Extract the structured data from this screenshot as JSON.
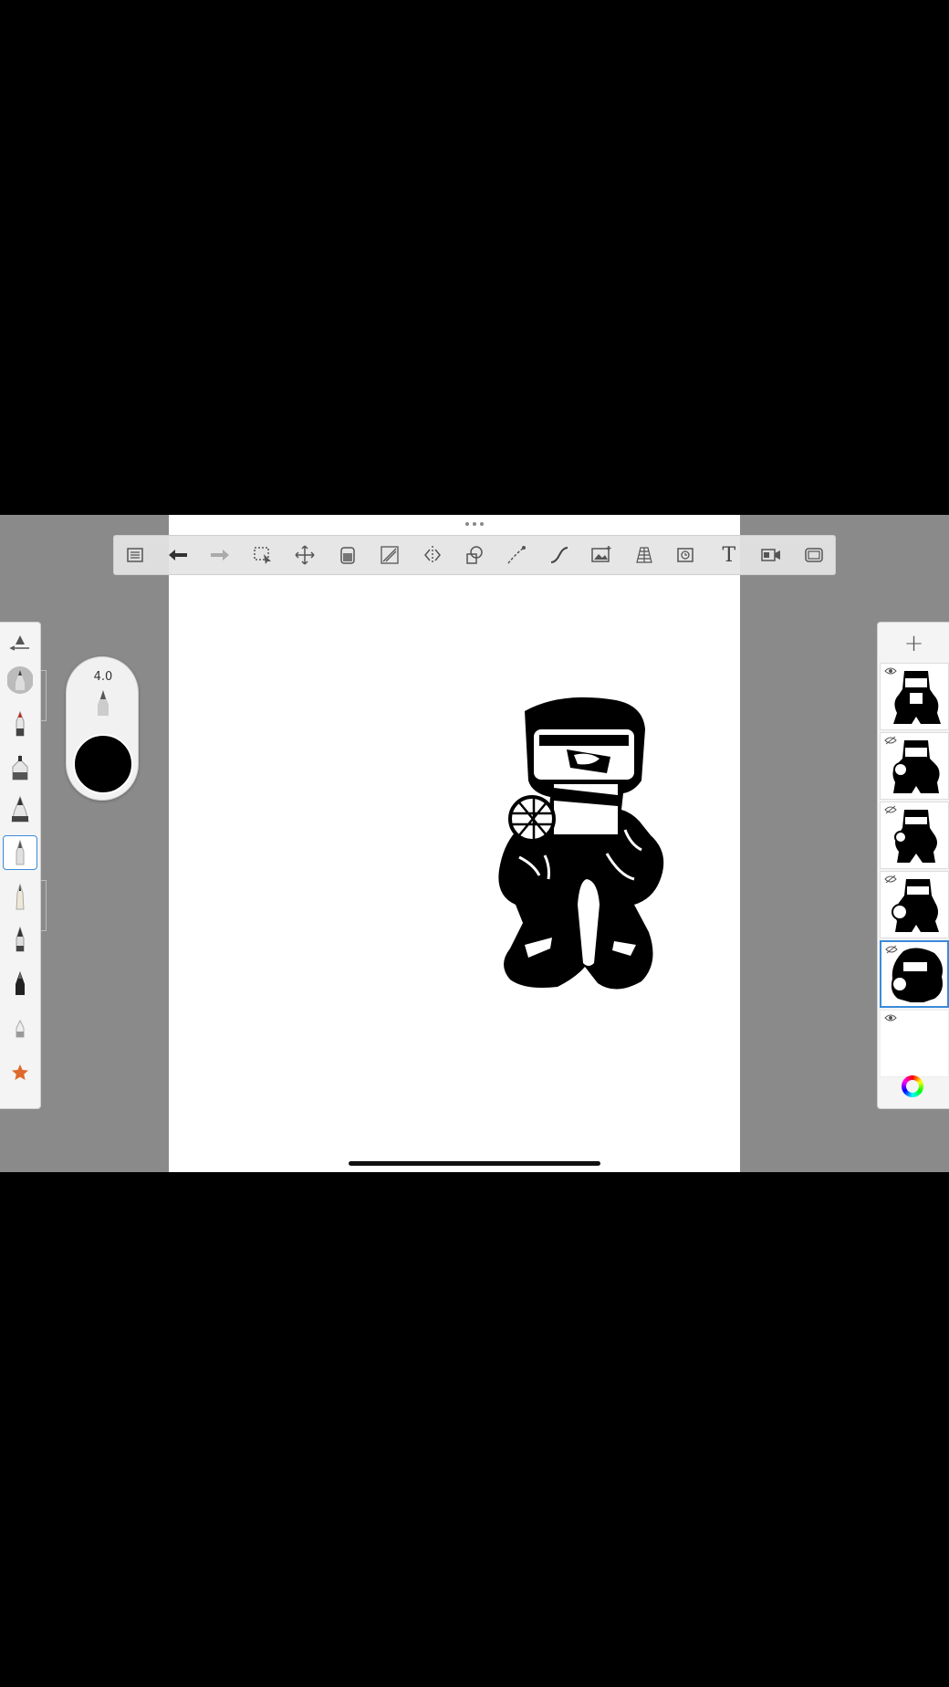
{
  "toolbar": {
    "tools": [
      "menu-icon",
      "undo-icon",
      "redo-icon",
      "selection-icon",
      "transform-icon",
      "fill-icon",
      "ruler-icon",
      "symmetry-icon",
      "shapes-icon",
      "stroke-icon",
      "curve-icon",
      "image-icon",
      "perspective-icon",
      "timelapse-icon",
      "text-icon",
      "record-icon",
      "fullscreen-icon"
    ],
    "text_tool_label": "T"
  },
  "brush": {
    "size": "4.0",
    "color": "#000000"
  },
  "left_tools": [
    "brush-settings-icon",
    "pencil-icon",
    "marker-icon",
    "airbrush-icon",
    "paintbrush-icon",
    "technical-pen-icon",
    "fineliner-icon",
    "calligraphy-pen-icon",
    "ink-pen-icon",
    "eraser-icon",
    "favorites-icon"
  ],
  "layers": {
    "add_label": "+",
    "count": 6,
    "selected_index": 4
  },
  "colors": {
    "accent": "#3a8bd9",
    "background": "#8a8a8a",
    "canvas": "#ffffff"
  }
}
